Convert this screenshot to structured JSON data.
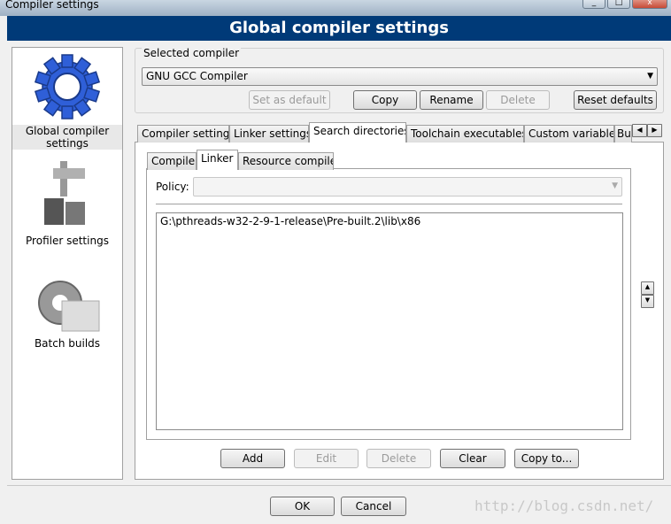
{
  "window": {
    "title": "Compiler settings",
    "min": "_",
    "max": "□",
    "close": "x"
  },
  "header": {
    "title": "Global compiler settings"
  },
  "sidebar": {
    "items": [
      {
        "label": "Global compiler settings",
        "icon": "gear-icon",
        "selected": true
      },
      {
        "label": "Profiler settings",
        "icon": "caliper-icon"
      },
      {
        "label": "Batch builds",
        "icon": "batch-gear-icon"
      }
    ]
  },
  "compiler": {
    "group_label": "Selected compiler",
    "selected": "GNU GCC Compiler",
    "buttons": {
      "set_default": "Set as default",
      "copy": "Copy",
      "rename": "Rename",
      "delete": "Delete",
      "reset": "Reset defaults"
    }
  },
  "tabs": [
    "Compiler settings",
    "Linker settings",
    "Search directories",
    "Toolchain executables",
    "Custom variables",
    "Bui"
  ],
  "active_tab": "Search directories",
  "subtabs": [
    "Compiler",
    "Linker",
    "Resource compiler"
  ],
  "active_subtab": "Linker",
  "policy": {
    "label": "Policy:",
    "value": ""
  },
  "directories": [
    "G:\\pthreads-w32-2-9-1-release\\Pre-built.2\\lib\\x86"
  ],
  "list_buttons": {
    "add": "Add",
    "edit": "Edit",
    "delete": "Delete",
    "clear": "Clear",
    "copy_to": "Copy to..."
  },
  "dialog": {
    "ok": "OK",
    "cancel": "Cancel"
  },
  "watermark": "http://blog.csdn.net/",
  "colors": {
    "header": "#003a78"
  }
}
